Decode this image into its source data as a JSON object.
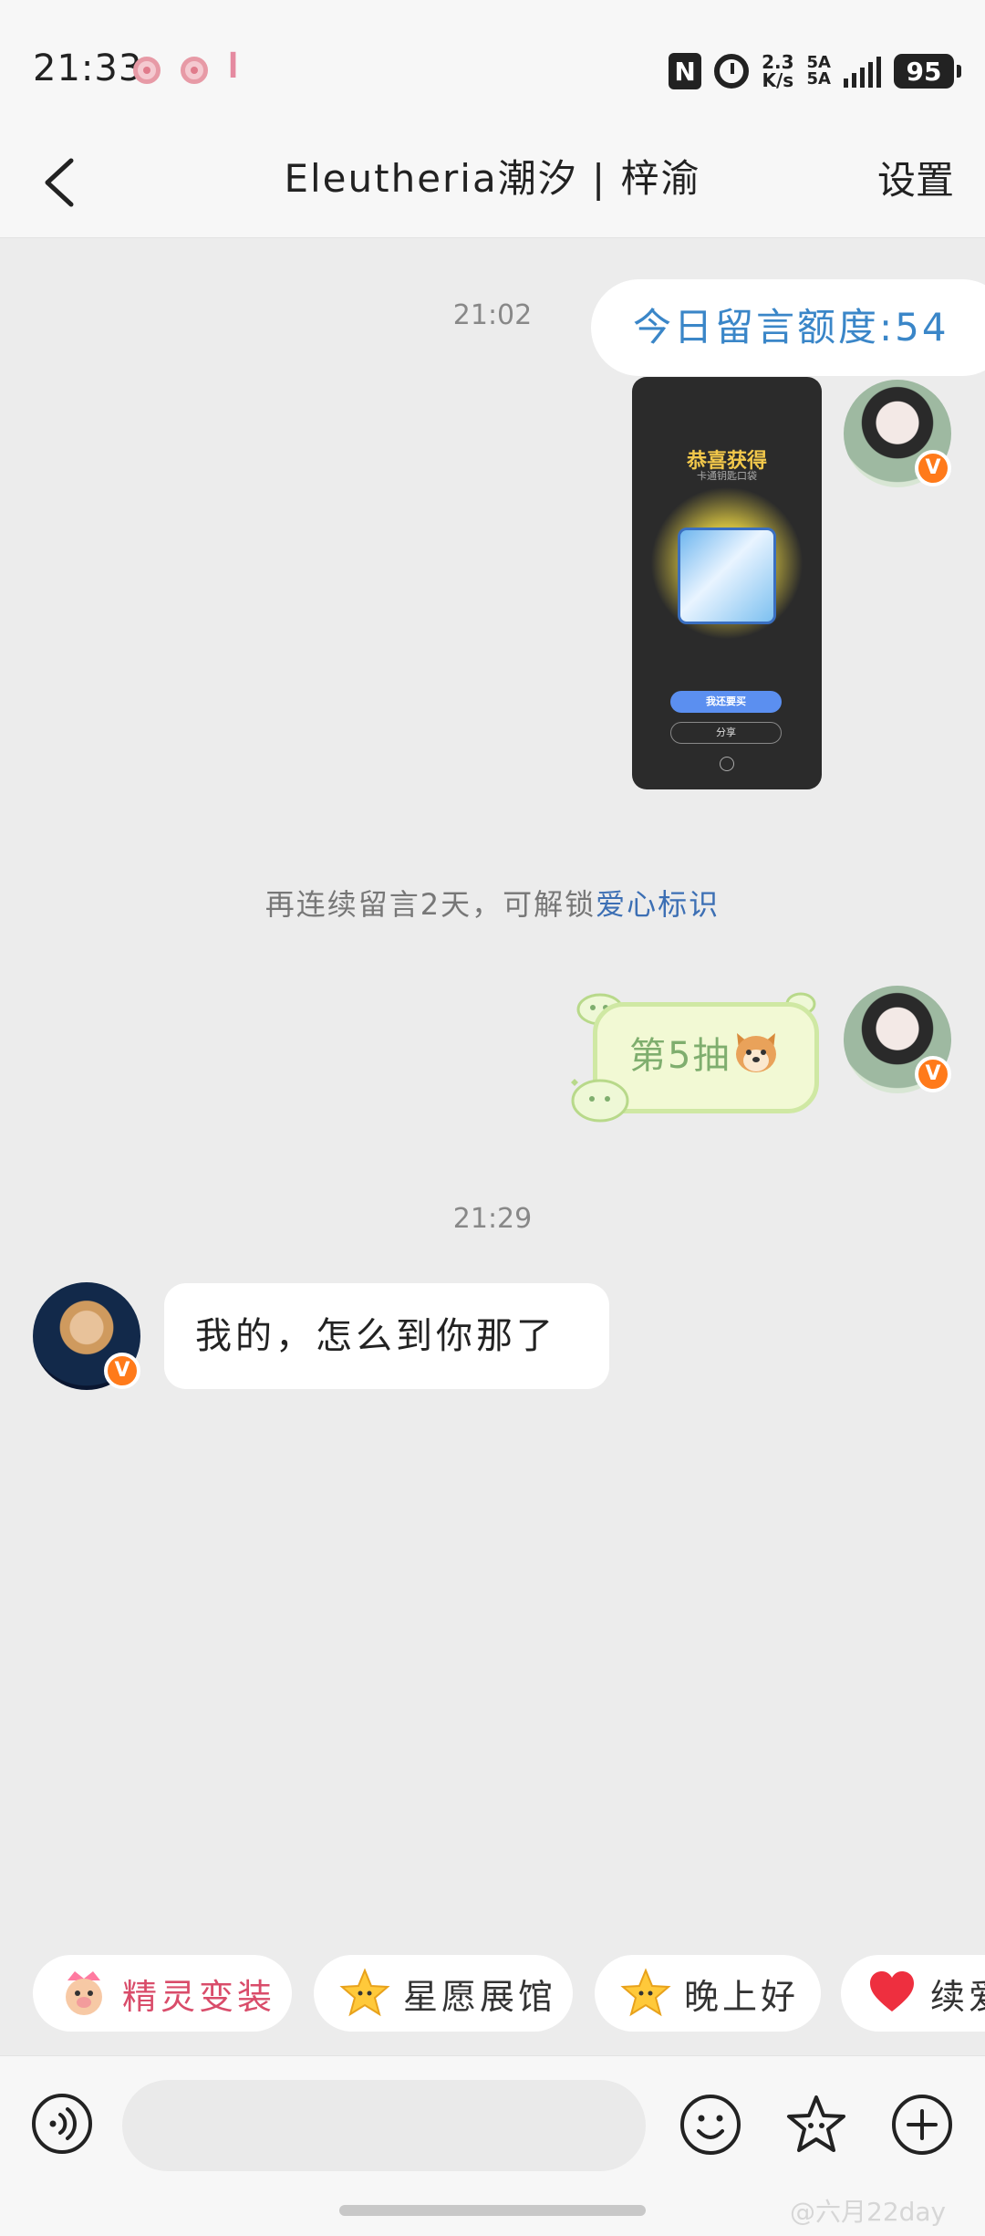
{
  "status_bar": {
    "time": "21:33",
    "nfc_label": "N",
    "net_speed_value": "2.3",
    "net_speed_unit": "K/s",
    "signal1": "5A",
    "signal2": "5A",
    "battery": "95"
  },
  "header": {
    "title": "Eleutheria潮汐 | 梓渝",
    "settings_label": "设置"
  },
  "messages": {
    "timestamp_1": "21:02",
    "quota_text": "今日留言额度:54",
    "photo": {
      "title": "恭喜获得",
      "subtitle": "卡通钥匙口袋",
      "buy_label": "我还要买",
      "share_label": "分享"
    },
    "system_note_prefix": "再连续留言2天，可解锁",
    "system_note_link": "爱心标识",
    "sticker_text": "第5抽",
    "timestamp_2": "21:29",
    "reply_text": "我的，怎么到你那了"
  },
  "quick_replies": [
    {
      "label": "精灵变装",
      "icon": "pig-costume-icon",
      "color": "#d94c6a"
    },
    {
      "label": "星愿展馆",
      "icon": "star-face-icon",
      "color": "#333333"
    },
    {
      "label": "晚上好",
      "icon": "star-face-icon",
      "color": "#333333"
    },
    {
      "label": "续爱",
      "icon": "heart-icon",
      "color": "#333333"
    }
  ],
  "input": {
    "placeholder": ""
  },
  "watermark": "@六月22day",
  "colors": {
    "accent_blue": "#3a86c8",
    "link_blue": "#3c6fb4",
    "vip_orange": "#ff7a1a",
    "sticker_green": "#7fae6e"
  }
}
